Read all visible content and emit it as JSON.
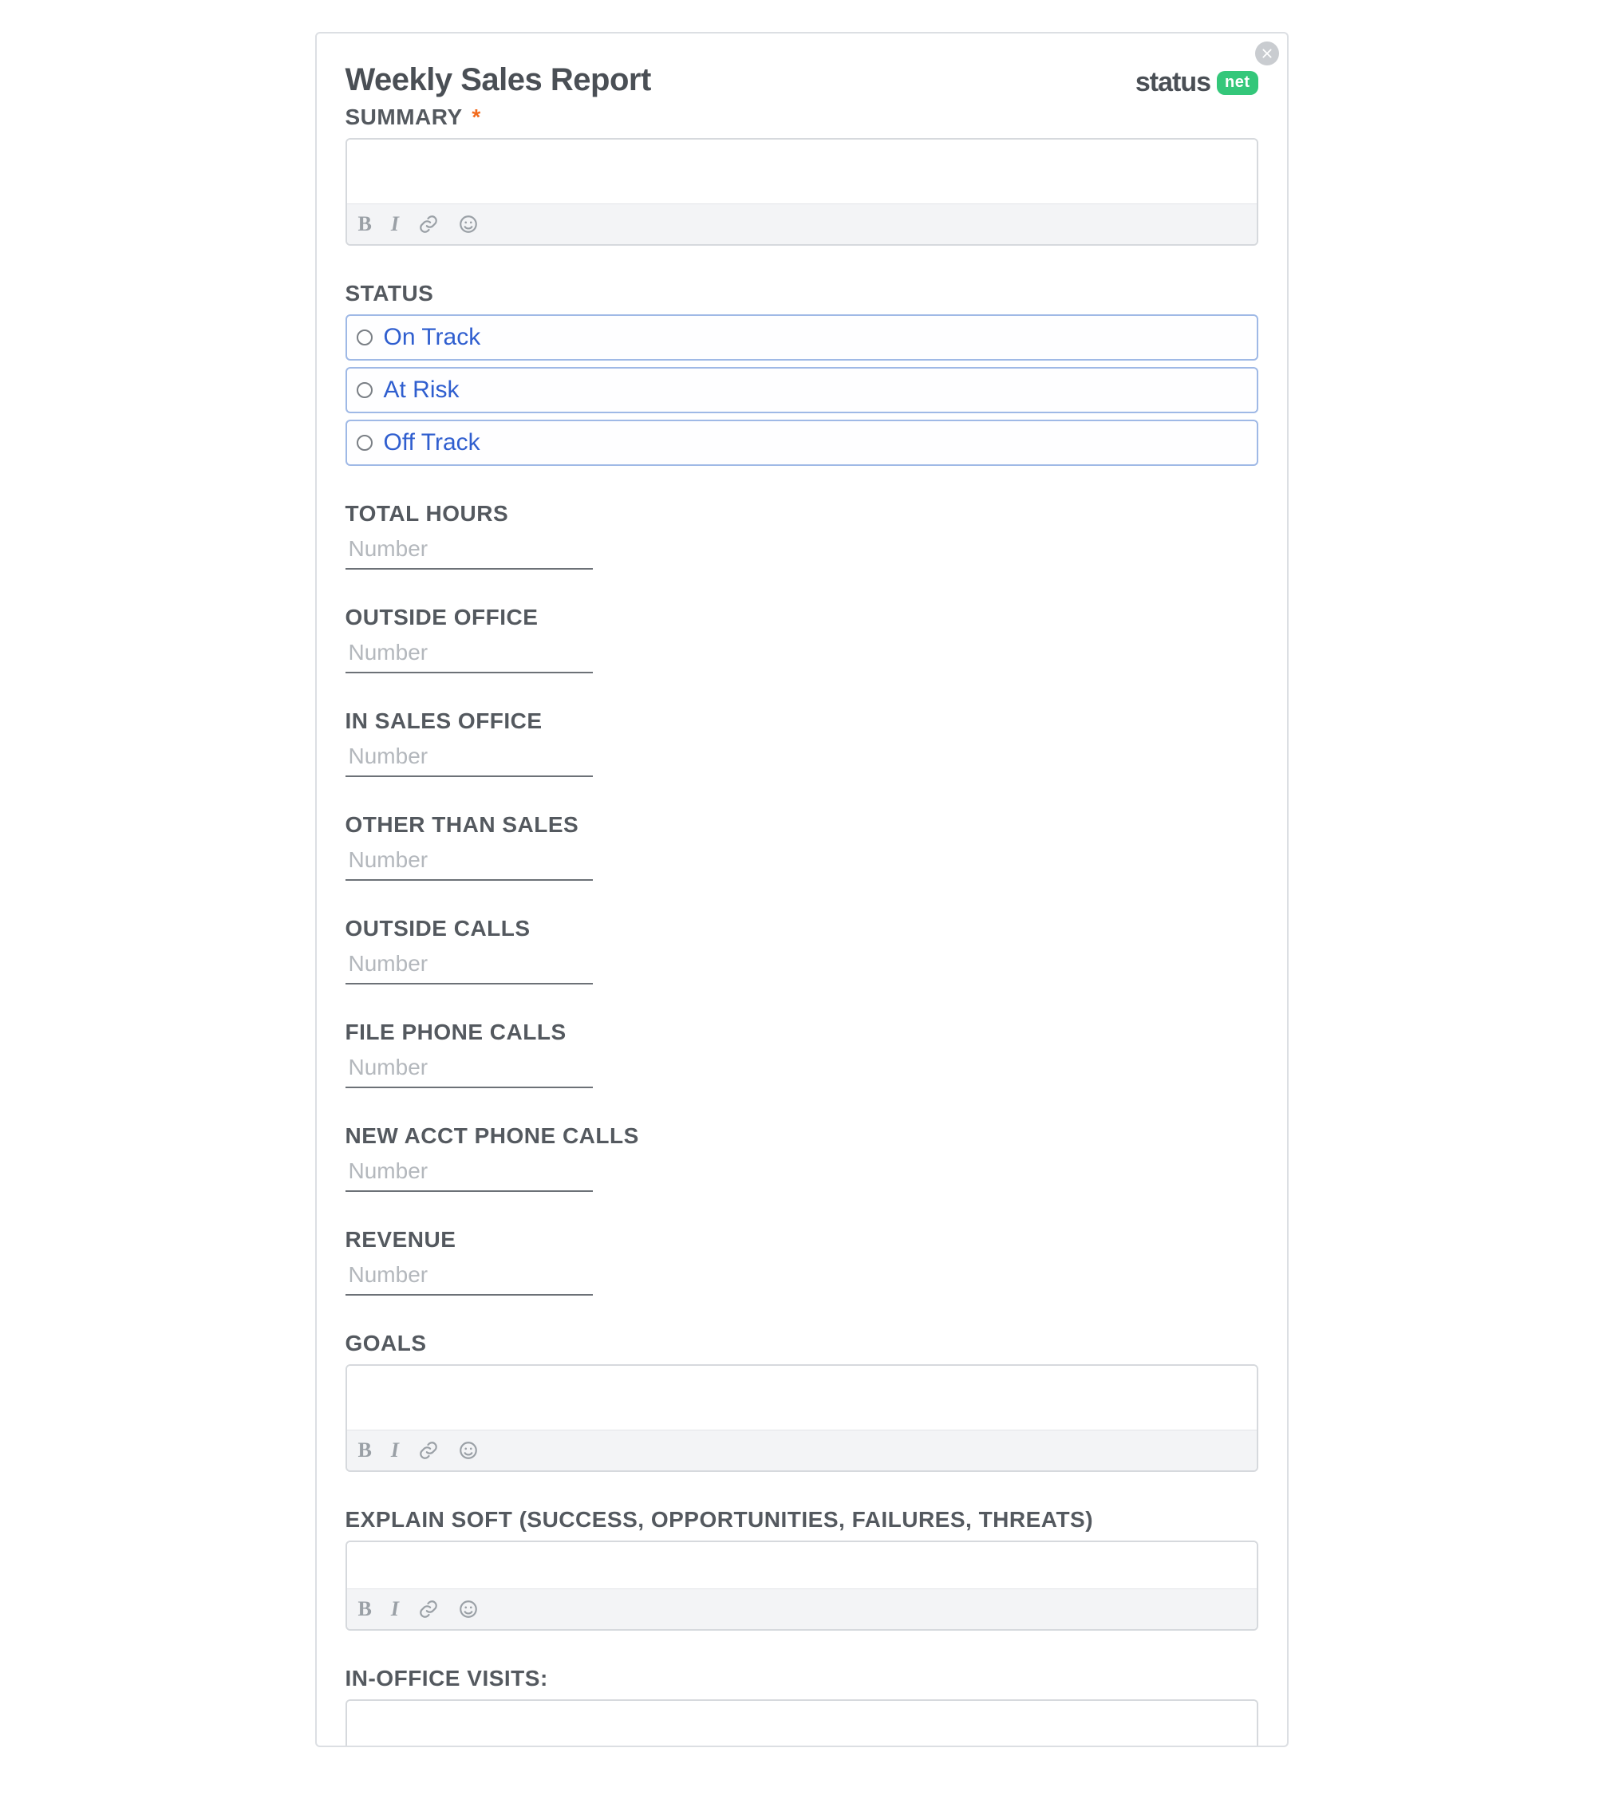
{
  "header": {
    "title": "Weekly Sales Report",
    "brand_word": "status",
    "brand_pill": "net"
  },
  "labels": {
    "summary": "SUMMARY",
    "status": "STATUS",
    "total_hours": "TOTAL HOURS",
    "outside_office": "OUTSIDE OFFICE",
    "in_sales_office": "IN SALES OFFICE",
    "other_than_sales": "OTHER THAN SALES",
    "outside_calls": "OUTSIDE CALLS",
    "file_phone_calls": "FILE PHONE CALLS",
    "new_acct_phone_calls": "NEW ACCT PHONE CALLS",
    "revenue": "REVENUE",
    "goals": "GOALS",
    "explain_soft": "EXPLAIN SOFT (SUCCESS, OPPORTUNITIES, FAILURES, THREATS)",
    "in_office_visits": "IN-OFFICE VISITS:"
  },
  "required_marker": "*",
  "status_options": [
    "On Track",
    "At Risk",
    "Off Track"
  ],
  "placeholders": {
    "number": "Number"
  },
  "values": {
    "summary": "",
    "status_selected": "",
    "total_hours": "",
    "outside_office": "",
    "in_sales_office": "",
    "other_than_sales": "",
    "outside_calls": "",
    "file_phone_calls": "",
    "new_acct_phone_calls": "",
    "revenue": "",
    "goals": "",
    "explain_soft": "",
    "in_office_visits": ""
  }
}
